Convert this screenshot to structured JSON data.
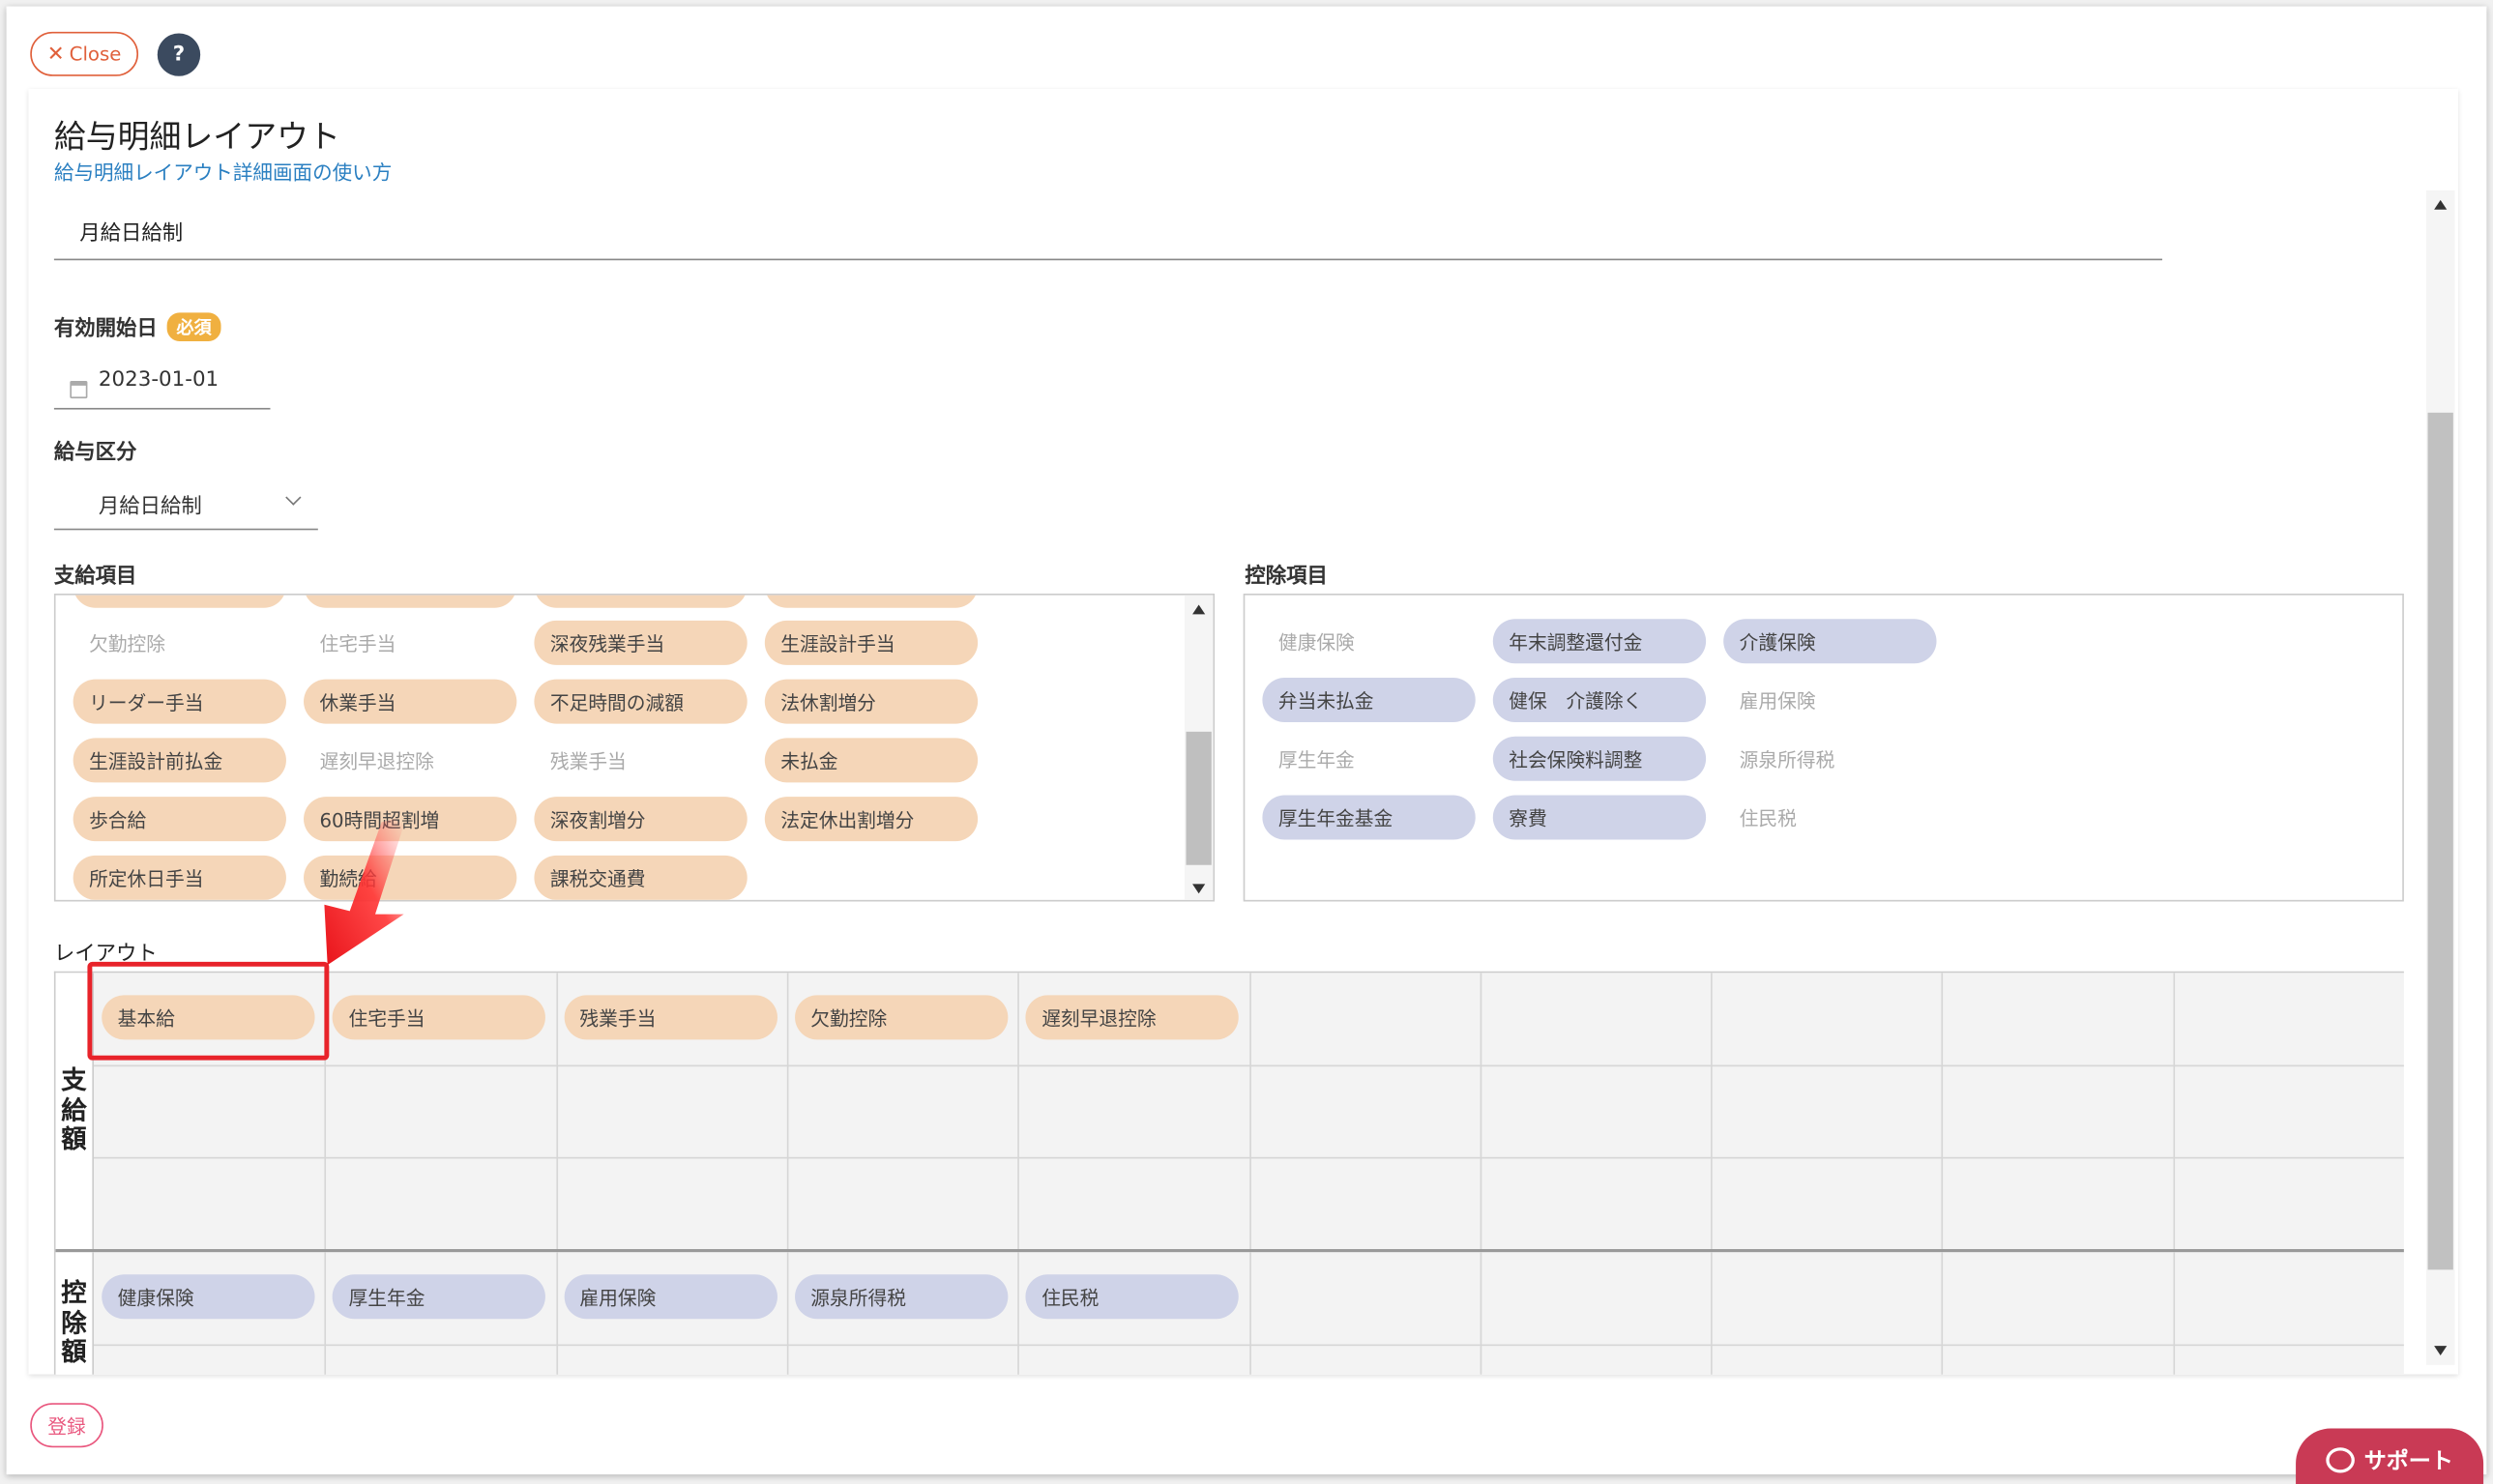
{
  "header": {
    "close_label": "Close",
    "help_label": "?",
    "title": "給与明細レイアウト",
    "help_link": "給与明細レイアウト詳細画面の使い方"
  },
  "form": {
    "layout_name": "月給日給制",
    "start_date_label": "有効開始日",
    "required_badge": "必須",
    "start_date_value": "2023-01-01",
    "pay_type_label": "給与区分",
    "pay_type_value": "月給日給制"
  },
  "payment_items": {
    "label": "支給項目",
    "rows": [
      [
        {
          "t": "欠勤控除",
          "s": "plain"
        },
        {
          "t": "住宅手当",
          "s": "plain"
        },
        {
          "t": "深夜残業手当",
          "s": "pay"
        },
        {
          "t": "生涯設計手当",
          "s": "pay"
        }
      ],
      [
        {
          "t": "リーダー手当",
          "s": "pay"
        },
        {
          "t": "休業手当",
          "s": "pay"
        },
        {
          "t": "不足時間の減額",
          "s": "pay"
        },
        {
          "t": "法休割増分",
          "s": "pay"
        }
      ],
      [
        {
          "t": "生涯設計前払金",
          "s": "pay"
        },
        {
          "t": "遅刻早退控除",
          "s": "plain"
        },
        {
          "t": "残業手当",
          "s": "plain"
        },
        {
          "t": "未払金",
          "s": "pay"
        }
      ],
      [
        {
          "t": "歩合給",
          "s": "pay"
        },
        {
          "t": "60時間超割増",
          "s": "pay"
        },
        {
          "t": "深夜割増分",
          "s": "pay"
        },
        {
          "t": "法定休出割増分",
          "s": "pay"
        }
      ],
      [
        {
          "t": "所定休日手当",
          "s": "pay"
        },
        {
          "t": "勤続給",
          "s": "pay"
        },
        {
          "t": "課税交通費",
          "s": "pay"
        }
      ]
    ]
  },
  "deduction_items": {
    "label": "控除項目",
    "rows": [
      [
        {
          "t": "健康保険",
          "s": "plain"
        },
        {
          "t": "年末調整還付金",
          "s": "ded"
        },
        {
          "t": "介護保険",
          "s": "ded"
        }
      ],
      [
        {
          "t": "弁当未払金",
          "s": "ded"
        },
        {
          "t": "健保　介護除く",
          "s": "ded"
        },
        {
          "t": "雇用保険",
          "s": "plain"
        }
      ],
      [
        {
          "t": "厚生年金",
          "s": "plain"
        },
        {
          "t": "社会保険料調整",
          "s": "ded"
        },
        {
          "t": "源泉所得税",
          "s": "plain"
        }
      ],
      [
        {
          "t": "厚生年金基金",
          "s": "ded"
        },
        {
          "t": "寮費",
          "s": "ded"
        },
        {
          "t": "住民税",
          "s": "plain"
        }
      ]
    ]
  },
  "layout": {
    "label": "レイアウト",
    "payment_side": "支給額",
    "deduction_side": "控除額",
    "payment_chips": [
      "基本給",
      "住宅手当",
      "残業手当",
      "欠勤控除",
      "遅刻早退控除"
    ],
    "deduction_chips": [
      "健康保険",
      "厚生年金",
      "雇用保険",
      "源泉所得税",
      "住民税"
    ]
  },
  "footer": {
    "register_label": "登録",
    "support_label": "サポート"
  },
  "colors": {
    "payment_chip": "#f5d6b8",
    "deduction_chip": "#cfd3e8",
    "highlight": "#e8232a",
    "close_accent": "#e0603b",
    "support_bg": "#c93a55"
  }
}
